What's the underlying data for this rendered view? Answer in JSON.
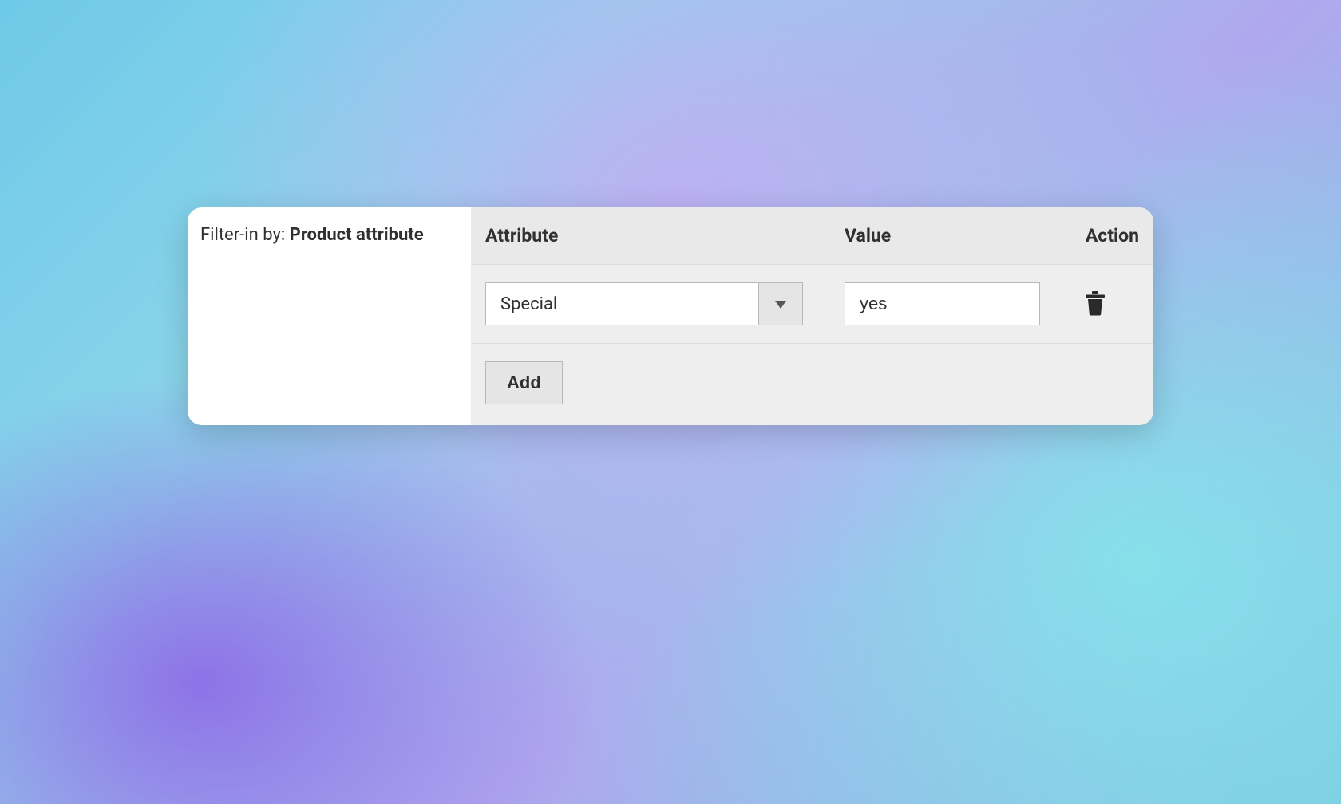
{
  "filter": {
    "prefix": "Filter-in by: ",
    "value": "Product attribute"
  },
  "grid": {
    "headers": {
      "attribute": "Attribute",
      "value": "Value",
      "action": "Action"
    },
    "rows": [
      {
        "attribute": "Special",
        "value": "yes"
      }
    ],
    "add_label": "Add"
  }
}
